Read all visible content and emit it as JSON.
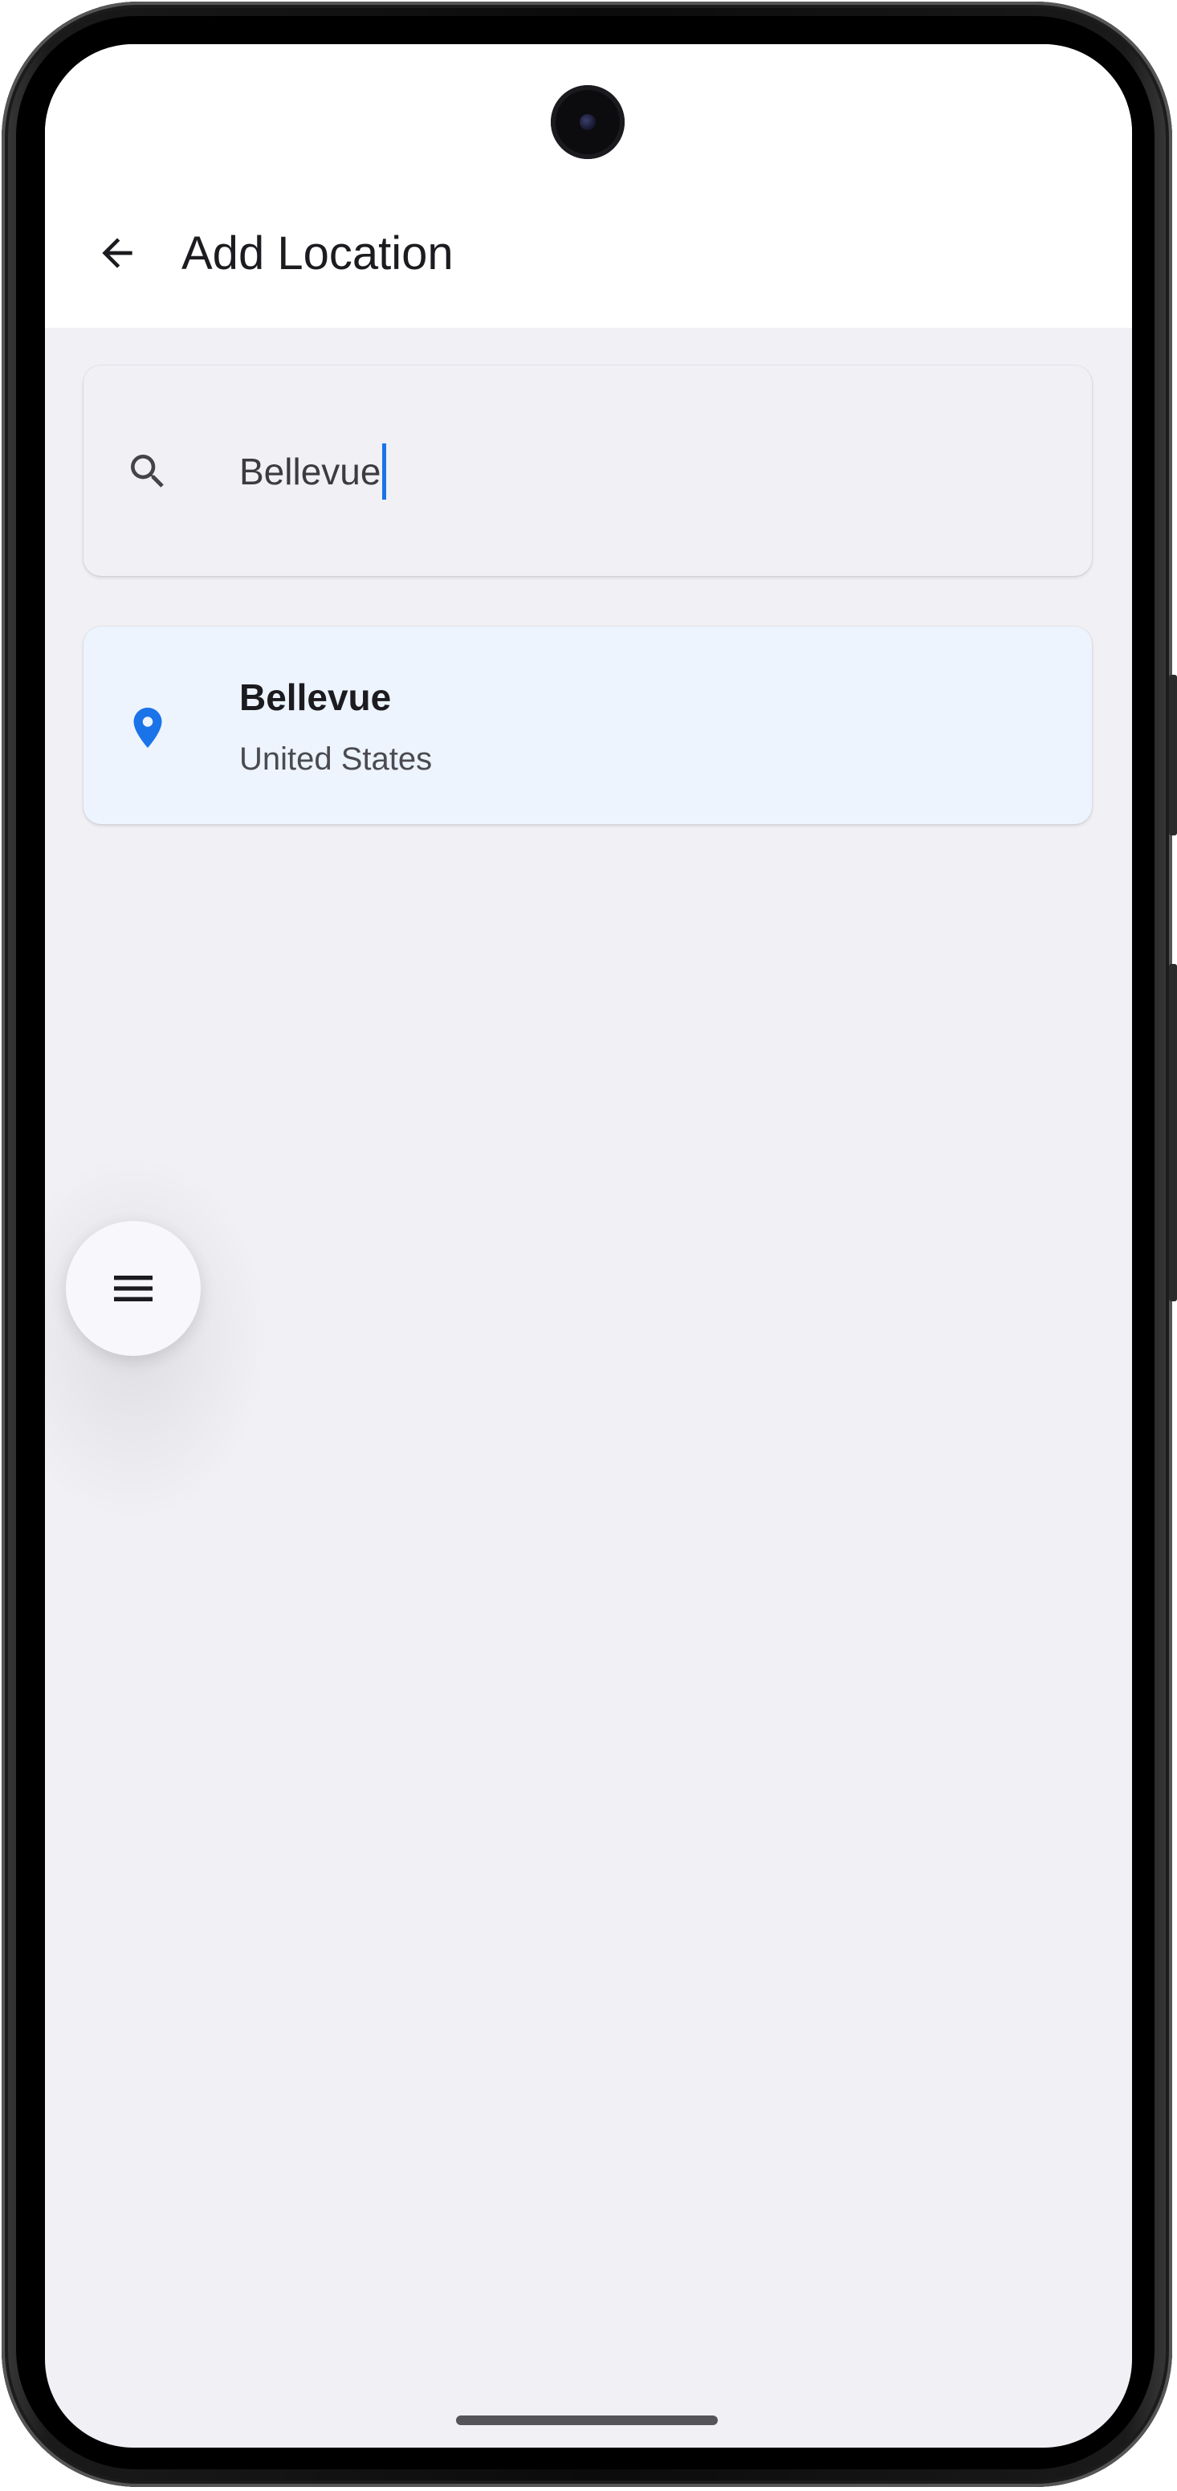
{
  "app_bar": {
    "title": "Add Location",
    "back_icon": "arrow-back-icon"
  },
  "search": {
    "icon": "search-icon",
    "value": "Bellevue",
    "cursor_color": "#1a73e8"
  },
  "results": [
    {
      "icon": "location-pin-icon",
      "name": "Bellevue",
      "country": "United States"
    }
  ],
  "fab": {
    "icon": "menu-icon"
  },
  "colors": {
    "accent": "#1a73e8",
    "background": "#f1f0f5",
    "result_highlight": "#edf4fd"
  }
}
